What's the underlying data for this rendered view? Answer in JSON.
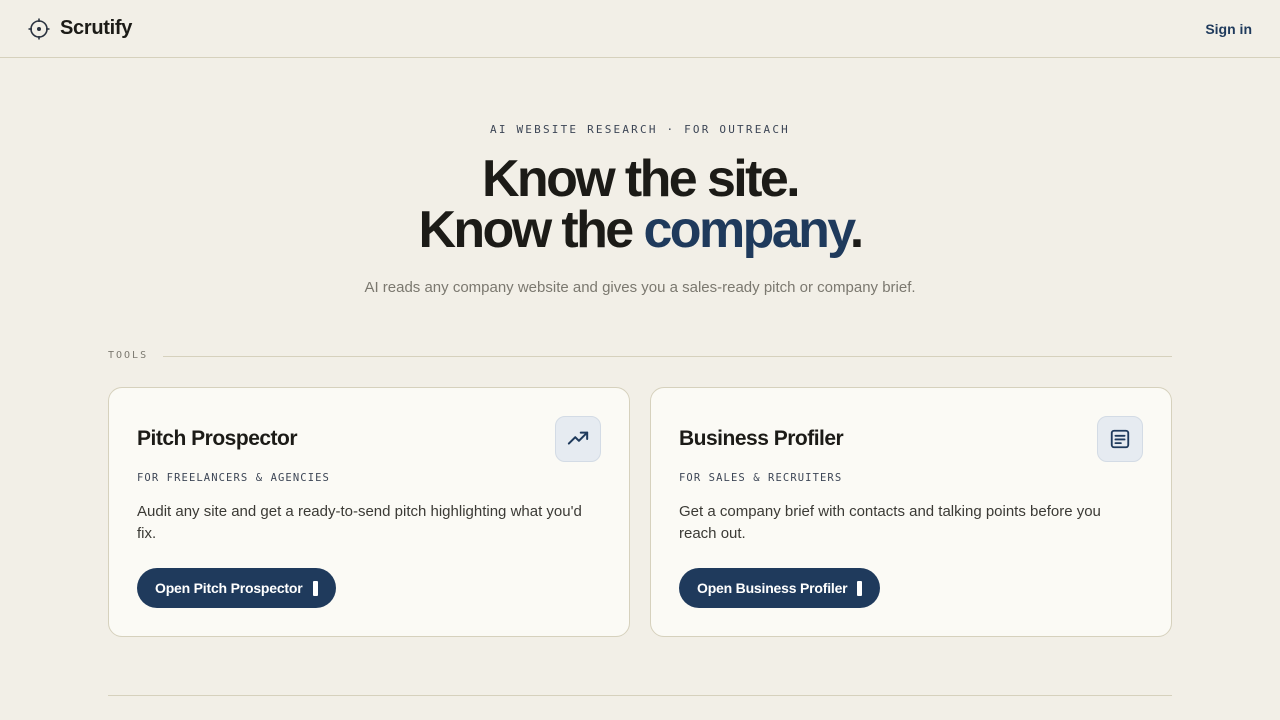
{
  "header": {
    "brand": "Scrutify",
    "brand_icon": "crosshair-icon",
    "signin_label": "Sign in"
  },
  "hero": {
    "eyebrow": "AI WEBSITE RESEARCH · FOR OUTREACH",
    "line1": "Know the site.",
    "line2_prefix": "Know the ",
    "line2_accent": "company",
    "line2_suffix": ".",
    "subtitle": "AI reads any company website and gives you a sales-ready pitch or company brief."
  },
  "tools": {
    "section_label": "TOOLS",
    "cards": [
      {
        "title": "Pitch Prospector",
        "icon": "trending-up-icon",
        "tag": "FOR FREELANCERS & AGENCIES",
        "description": "Audit any site and get a ready-to-send pitch highlighting what you'd fix.",
        "button_label": "Open Pitch Prospector"
      },
      {
        "title": "Business Profiler",
        "icon": "document-icon",
        "tag": "FOR SALES & RECRUITERS",
        "description": "Get a company brief with contacts and talking points before you reach out.",
        "button_label": "Open Business Profiler"
      }
    ]
  },
  "colors": {
    "background": "#f2efe7",
    "accent": "#1f3a5c",
    "card_background": "#fbfaf5",
    "border": "#d6d1bd"
  }
}
